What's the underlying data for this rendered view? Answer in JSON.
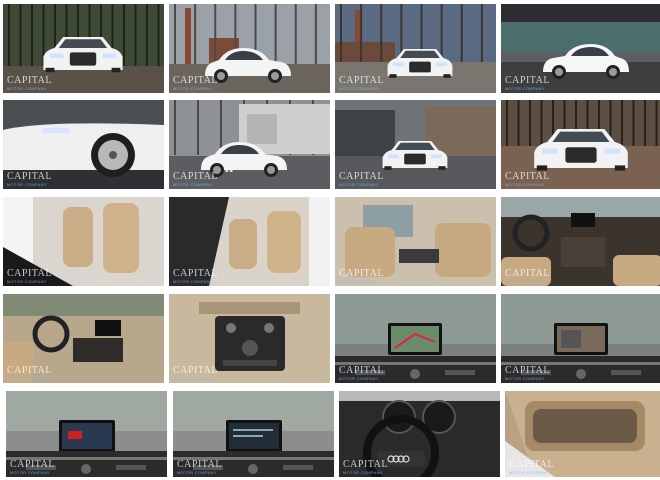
{
  "watermark": {
    "brand": "CAPITAL",
    "tagline": "MOTOR COMPANY"
  },
  "rows": [
    [
      {
        "label": "Front three-quarter exterior in forest",
        "scene": "ext-forest"
      },
      {
        "label": "Rear three-quarter with smokestacks",
        "scene": "ext-rear-stack"
      },
      {
        "label": "Front view with smokestack",
        "scene": "ext-front-stack"
      },
      {
        "label": "Side profile under bridge",
        "scene": "ext-side-bridge"
      }
    ],
    [
      {
        "label": "Front wheel close-up",
        "scene": "ext-wheel"
      },
      {
        "label": "Front three-quarter near building",
        "scene": "ext-building"
      },
      {
        "label": "Front three-quarter by garage",
        "scene": "ext-garage"
      },
      {
        "label": "Front grille on gravel",
        "scene": "ext-gravel"
      }
    ],
    [
      {
        "label": "Front seats from driver door",
        "scene": "int-seats"
      },
      {
        "label": "Front seats angled view",
        "scene": "int-seats2"
      },
      {
        "label": "Rear seats with console",
        "scene": "int-rear"
      },
      {
        "label": "Dashboard from rear",
        "scene": "int-dash"
      }
    ],
    [
      {
        "label": "Dashboard from passenger door",
        "scene": "int-dash2"
      },
      {
        "label": "Center console controls",
        "scene": "int-console"
      },
      {
        "label": "Navigation screen map",
        "scene": "int-nav"
      },
      {
        "label": "Navigation screen camera",
        "scene": "int-cam"
      }
    ],
    [
      {
        "label": "Infotainment screen",
        "scene": "int-screen1"
      },
      {
        "label": "Infotainment screen 2",
        "scene": "int-screen2"
      },
      {
        "label": "Steering wheel and gauges",
        "scene": "int-wheel"
      },
      {
        "label": "Door panel speaker",
        "scene": "int-door"
      }
    ]
  ]
}
